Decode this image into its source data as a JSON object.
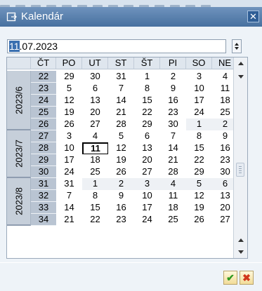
{
  "window": {
    "title": "Kalendár",
    "close_glyph": "✕",
    "icon": "calendar-window-icon"
  },
  "date_field": {
    "value_selected": "11",
    "value_rest": ".07.2023"
  },
  "calendar": {
    "headers": [
      "ČT",
      "PO",
      "UT",
      "ST",
      "ŠT",
      "PI",
      "SO",
      "NE"
    ],
    "months": [
      {
        "label": "2023/6",
        "rows": 5
      },
      {
        "label": "2023/7",
        "rows": 4
      },
      {
        "label": "2023/8",
        "rows": 4
      }
    ],
    "weeks": [
      {
        "week": "22",
        "days": [
          "29",
          "30",
          "31",
          "1",
          "2",
          "3",
          "4"
        ],
        "other": [
          0,
          0,
          0,
          0,
          0,
          0,
          0
        ]
      },
      {
        "week": "23",
        "days": [
          "5",
          "6",
          "7",
          "8",
          "9",
          "10",
          "11"
        ],
        "other": [
          0,
          0,
          0,
          0,
          0,
          0,
          0
        ]
      },
      {
        "week": "24",
        "days": [
          "12",
          "13",
          "14",
          "15",
          "16",
          "17",
          "18"
        ],
        "other": [
          0,
          0,
          0,
          0,
          0,
          0,
          0
        ]
      },
      {
        "week": "25",
        "days": [
          "19",
          "20",
          "21",
          "22",
          "23",
          "24",
          "25"
        ],
        "other": [
          0,
          0,
          0,
          0,
          0,
          0,
          0
        ]
      },
      {
        "week": "26",
        "days": [
          "26",
          "27",
          "28",
          "29",
          "30",
          "1",
          "2"
        ],
        "other": [
          0,
          0,
          0,
          0,
          0,
          1,
          1
        ]
      },
      {
        "week": "27",
        "days": [
          "3",
          "4",
          "5",
          "6",
          "7",
          "8",
          "9"
        ],
        "other": [
          0,
          0,
          0,
          0,
          0,
          0,
          0
        ]
      },
      {
        "week": "28",
        "days": [
          "10",
          "11",
          "12",
          "13",
          "14",
          "15",
          "16"
        ],
        "other": [
          0,
          0,
          0,
          0,
          0,
          0,
          0
        ]
      },
      {
        "week": "29",
        "days": [
          "17",
          "18",
          "19",
          "20",
          "21",
          "22",
          "23"
        ],
        "other": [
          0,
          0,
          0,
          0,
          0,
          0,
          0
        ]
      },
      {
        "week": "30",
        "days": [
          "24",
          "25",
          "26",
          "27",
          "28",
          "29",
          "30"
        ],
        "other": [
          0,
          0,
          0,
          0,
          0,
          0,
          0
        ]
      },
      {
        "week": "31",
        "days": [
          "31",
          "1",
          "2",
          "3",
          "4",
          "5",
          "6"
        ],
        "other": [
          0,
          1,
          1,
          1,
          1,
          1,
          1
        ]
      },
      {
        "week": "32",
        "days": [
          "7",
          "8",
          "9",
          "10",
          "11",
          "12",
          "13"
        ],
        "other": [
          0,
          0,
          0,
          0,
          0,
          0,
          0
        ]
      },
      {
        "week": "33",
        "days": [
          "14",
          "15",
          "16",
          "17",
          "18",
          "19",
          "20"
        ],
        "other": [
          0,
          0,
          0,
          0,
          0,
          0,
          0
        ]
      },
      {
        "week": "34",
        "days": [
          "21",
          "22",
          "23",
          "24",
          "25",
          "26",
          "27"
        ],
        "other": [
          0,
          0,
          0,
          0,
          0,
          0,
          0
        ]
      }
    ],
    "today": {
      "week": "28",
      "day": "11"
    }
  },
  "buttons": {
    "ok_glyph": "✔",
    "cancel_glyph": "✖"
  },
  "colors": {
    "titlebar": "#47709f",
    "week_column": "#b9c4d2",
    "month_column": "#c6cfda",
    "ok": "#2f9a22",
    "cancel": "#d1361c"
  }
}
